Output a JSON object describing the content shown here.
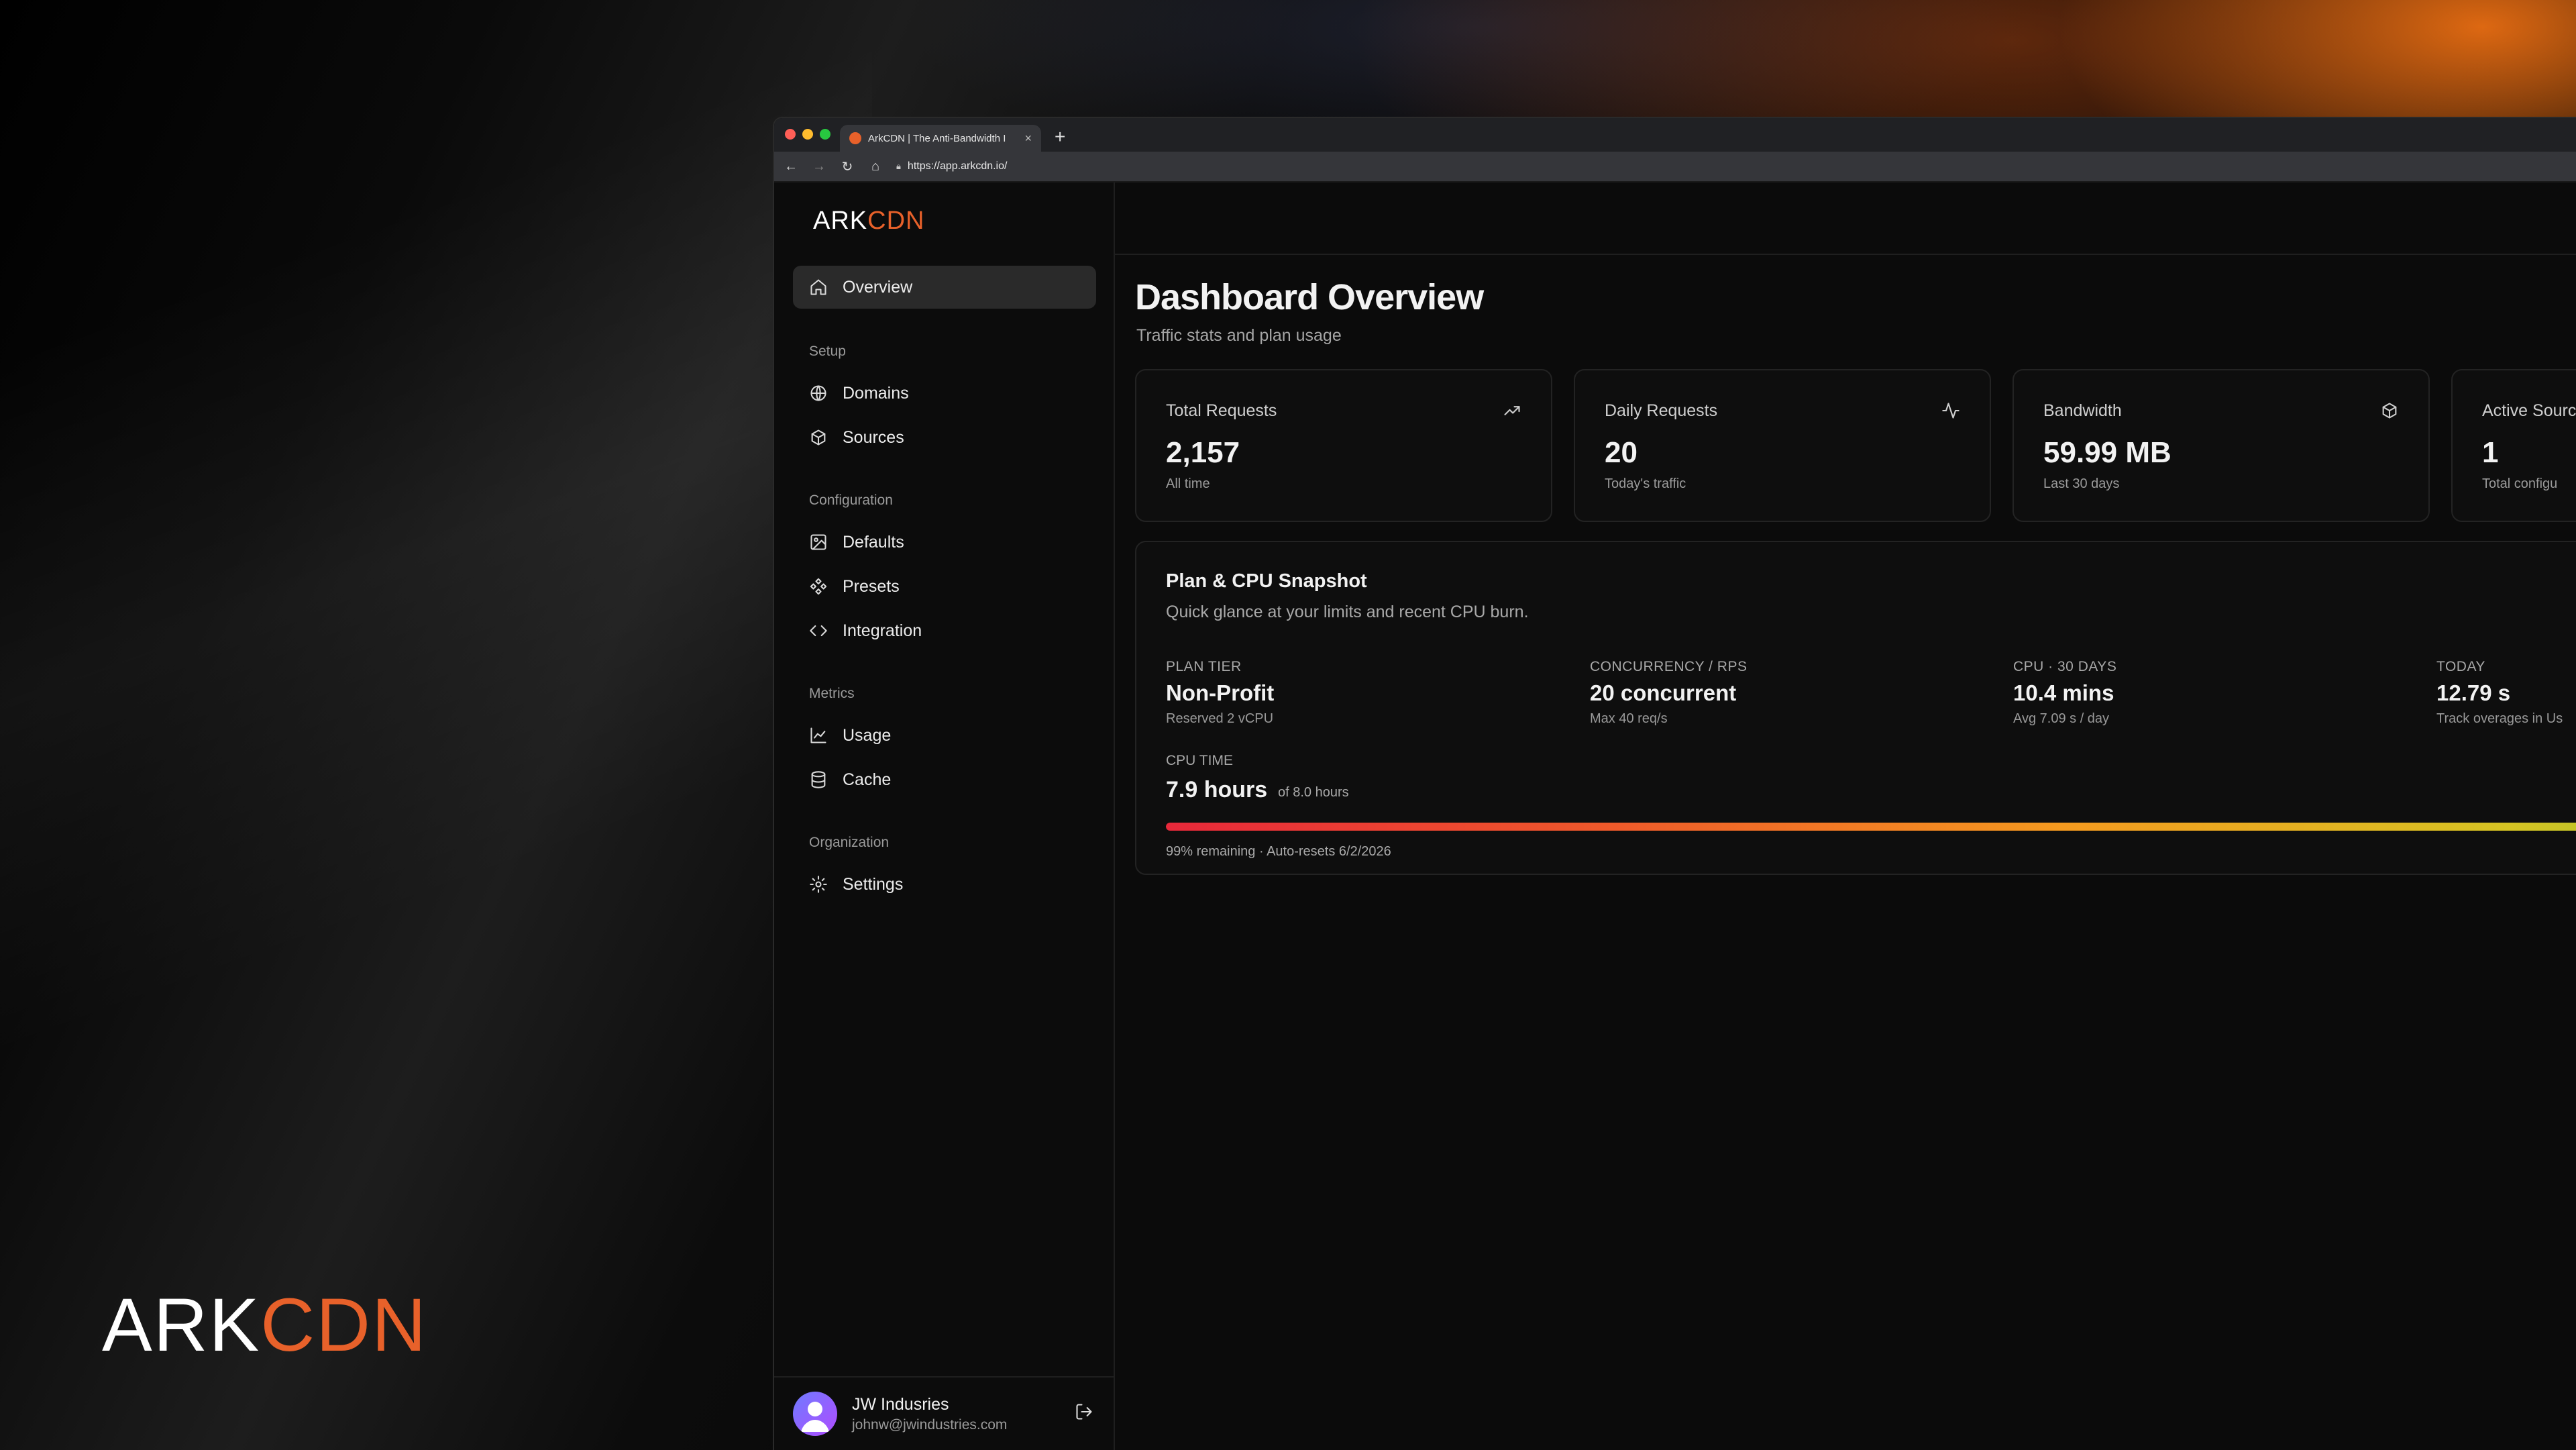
{
  "brand": {
    "ark": "ARK",
    "cdn": "CDN",
    "accent_color": "#e8612a"
  },
  "browser": {
    "tab_title": "ArkCDN | The Anti-Bandwidth I",
    "tab_close": "×",
    "new_tab": "+",
    "url": "https://app.arkcdn.io/"
  },
  "sidebar": {
    "overview": "Overview",
    "sections": {
      "setup": "Setup",
      "configuration": "Configuration",
      "metrics": "Metrics",
      "organization": "Organization"
    },
    "items": {
      "domains": "Domains",
      "sources": "Sources",
      "defaults": "Defaults",
      "presets": "Presets",
      "integration": "Integration",
      "usage": "Usage",
      "cache": "Cache",
      "settings": "Settings"
    },
    "user": {
      "name": "JW Indusries",
      "email": "johnw@jwindustries.com"
    }
  },
  "main": {
    "title": "Dashboard Overview",
    "subtitle": "Traffic stats and plan usage",
    "cards": [
      {
        "label": "Total Requests",
        "value": "2,157",
        "sub": "All time",
        "icon": "trending-up-icon"
      },
      {
        "label": "Daily Requests",
        "value": "20",
        "sub": "Today's traffic",
        "icon": "activity-icon"
      },
      {
        "label": "Bandwidth",
        "value": "59.99 MB",
        "sub": "Last 30 days",
        "icon": "package-icon"
      },
      {
        "label": "Active Sourc",
        "value": "1",
        "sub": "Total configu",
        "icon": ""
      }
    ],
    "plan": {
      "title": "Plan & CPU Snapshot",
      "subtitle": "Quick glance at your limits and recent CPU burn.",
      "stats": [
        {
          "k": "PLAN TIER",
          "v": "Non-Profit",
          "d": "Reserved 2 vCPU"
        },
        {
          "k": "CONCURRENCY / RPS",
          "v": "20 concurrent",
          "d": "Max 40 req/s"
        },
        {
          "k": "CPU · 30 DAYS",
          "v": "10.4 mins",
          "d": "Avg 7.09 s / day"
        },
        {
          "k": "TODAY",
          "v": "12.79 s",
          "d": "Track overages in Us"
        }
      ],
      "cpu_label": "CPU TIME",
      "cpu_value": "7.9 hours",
      "cpu_of": "of 8.0 hours",
      "cpu_remaining_fraction": 0.99,
      "bar_note": "99% remaining · Auto-resets 6/2/2026"
    }
  }
}
